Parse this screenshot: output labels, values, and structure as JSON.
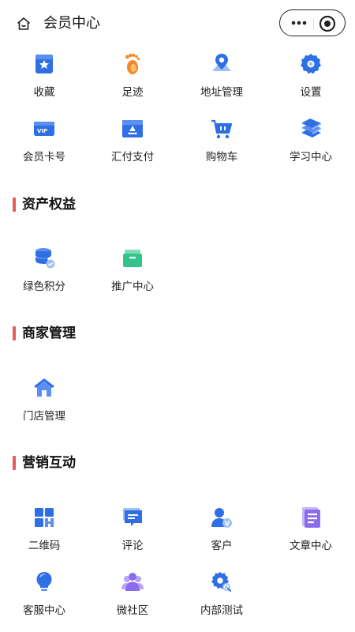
{
  "header": {
    "title": "会员中心",
    "home_icon": "home-icon",
    "more_icon": "more-dots-icon",
    "close_icon": "target-close-icon"
  },
  "top_grid": [
    {
      "label": "收藏",
      "icon": "favorite-star-icon"
    },
    {
      "label": "足迹",
      "icon": "footprint-icon"
    },
    {
      "label": "地址管理",
      "icon": "map-pin-icon"
    },
    {
      "label": "设置",
      "icon": "gear-icon"
    },
    {
      "label": "会员卡号",
      "icon": "vip-card-icon"
    },
    {
      "label": "汇付支付",
      "icon": "payment-card-icon"
    },
    {
      "label": "购物车",
      "icon": "shopping-cart-icon"
    },
    {
      "label": "学习中心",
      "icon": "books-icon"
    }
  ],
  "sections": [
    {
      "title": "资产权益",
      "items": [
        {
          "label": "绿色积分",
          "icon": "points-coins-icon"
        },
        {
          "label": "推广中心",
          "icon": "promotion-box-icon"
        }
      ]
    },
    {
      "title": "商家管理",
      "items": [
        {
          "label": "门店管理",
          "icon": "store-house-icon"
        }
      ]
    },
    {
      "title": "营销互动",
      "items": [
        {
          "label": "二维码",
          "icon": "qrcode-icon"
        },
        {
          "label": "评论",
          "icon": "comment-icon"
        },
        {
          "label": "客户",
          "icon": "customer-vip-icon"
        },
        {
          "label": "文章中心",
          "icon": "article-icon"
        },
        {
          "label": "客服中心",
          "icon": "lightbulb-service-icon"
        },
        {
          "label": "微社区",
          "icon": "community-icon"
        },
        {
          "label": "内部测试",
          "icon": "gear-search-icon"
        }
      ]
    }
  ],
  "colors": {
    "accent_bar": "#e65b5b",
    "icon_blue": "#2f6fe4",
    "icon_orange": "#f08a2c",
    "icon_green": "#33c48a",
    "icon_purple": "#8b6cf0"
  }
}
